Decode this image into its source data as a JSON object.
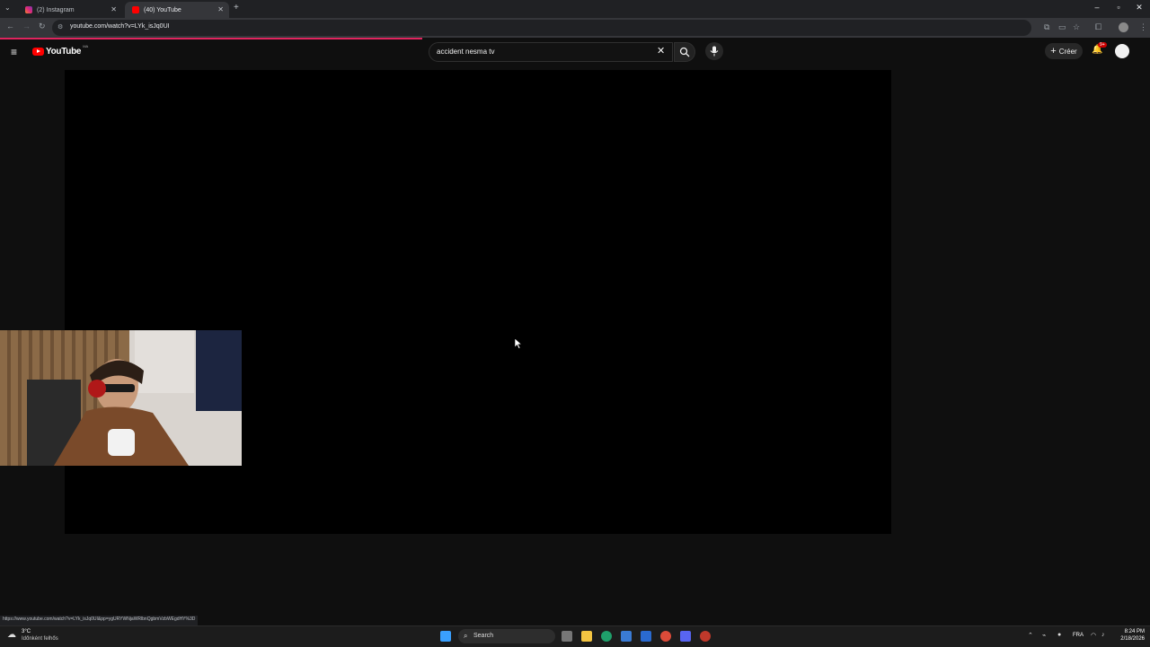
{
  "browser": {
    "tabs": [
      {
        "title": "(2) Instagram",
        "active": false
      },
      {
        "title": "(40) YouTube",
        "active": true
      }
    ],
    "url": "youtube.com/watch?v=LYk_isJq0UI",
    "status_url": "https://www.youtube.com/watch?v=LYk_isJq0UI&pp=ygURYWNjaWRlbnQgbmVzbWEgdHY%3D"
  },
  "youtube": {
    "logo_text": "YouTube",
    "country_code": "MA",
    "search_query": "accident nesma tv",
    "create_label": "Créer",
    "notification_badge": "9+"
  },
  "taskbar": {
    "weather_temp": "3°C",
    "weather_desc": "Időnként felhős",
    "search_label": "Search",
    "language": "FRA",
    "time": "8:24 PM",
    "date": "2/18/2026"
  },
  "colors": {
    "yt_red": "#ff0000",
    "loading_bar": "#e0245e",
    "background": "#0f0f0f"
  }
}
